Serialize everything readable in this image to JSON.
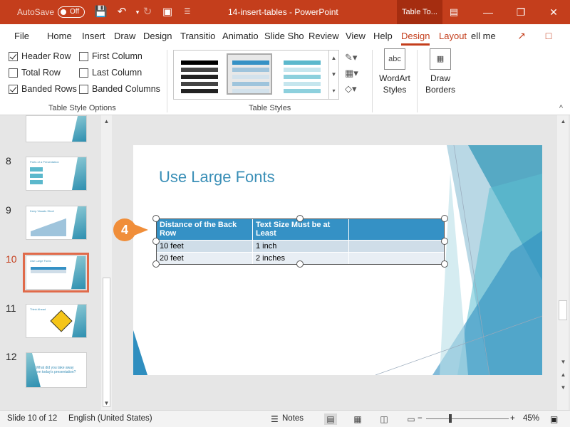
{
  "titlebar": {
    "autosave_label": "AutoSave",
    "autosave_state": "Off",
    "doc_title": "14-insert-tables  -  PowerPoint",
    "context_tab": "Table To...",
    "minimize": "—",
    "restore": "❐",
    "close": "✕"
  },
  "tabs": [
    "File",
    "Home",
    "Insert",
    "Draw",
    "Design",
    "Transitio",
    "Animatio",
    "Slide Sho",
    "Review",
    "View",
    "Help"
  ],
  "context_tabs": {
    "design": "Design",
    "layout": "Layout"
  },
  "tell_me": "ell me",
  "ribbon": {
    "style_options": {
      "header_row": "Header Row",
      "first_column": "First Column",
      "total_row": "Total Row",
      "last_column": "Last Column",
      "banded_rows": "Banded Rows",
      "banded_columns": "Banded Columns",
      "group_label": "Table Style Options"
    },
    "table_styles_label": "Table Styles",
    "wordart_line1": "WordArt",
    "wordart_line2": "Styles",
    "wordart_icon": "abc",
    "draw_line1": "Draw",
    "draw_line2": "Borders"
  },
  "thumbnails": [
    {
      "num": "8",
      "title": "Parts of a Presentation"
    },
    {
      "num": "9",
      "title": "Keep Visuals Short"
    },
    {
      "num": "10",
      "title": "Use Large Fonts"
    },
    {
      "num": "11",
      "title": "Think Ahead"
    },
    {
      "num": "12",
      "title": "What did you take away from today's presentation?"
    }
  ],
  "slide": {
    "title": "Use Large Fonts",
    "table": {
      "headers": [
        "Distance of the Back Row",
        "Text Size Must be at Least",
        ""
      ],
      "rows": [
        [
          "10 feet",
          "1 inch",
          ""
        ],
        [
          "20 feet",
          "2 inches",
          ""
        ]
      ]
    },
    "callout": "4"
  },
  "status": {
    "slide_info": "Slide 10 of 12",
    "language": "English (United States)",
    "notes": "Notes",
    "zoom": "45%"
  },
  "colors": {
    "accent": "#c43e1c",
    "table_header": "#3591c5",
    "callout": "#f08e3a"
  }
}
